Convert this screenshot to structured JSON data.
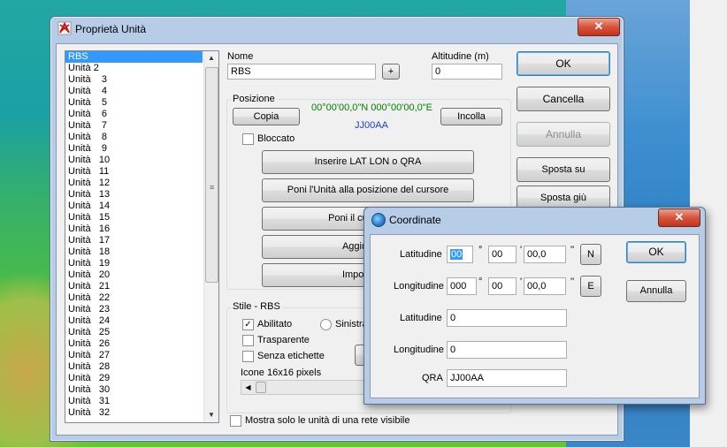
{
  "window": {
    "title": "Proprietà Unità",
    "close_label": "✕"
  },
  "unit_list": {
    "items": [
      "RBS",
      "Unità 2",
      "Unità    3",
      "Unità    4",
      "Unità    5",
      "Unità    6",
      "Unità    7",
      "Unità    8",
      "Unità    9",
      "Unità   10",
      "Unità   11",
      "Unità   12",
      "Unità   13",
      "Unità   14",
      "Unità   15",
      "Unità   16",
      "Unità   17",
      "Unità   18",
      "Unità   19",
      "Unità   20",
      "Unità   21",
      "Unità   22",
      "Unità   23",
      "Unità   24",
      "Unità   25",
      "Unità   26",
      "Unità   27",
      "Unità   28",
      "Unità   29",
      "Unità   30",
      "Unità   31",
      "Unità   32"
    ],
    "selected_index": 0
  },
  "name": {
    "label": "Nome",
    "value": "RBS",
    "plus_label": "+"
  },
  "altitude": {
    "label": "Altitudine (m)",
    "value": "0"
  },
  "position": {
    "group_label": "Posizione",
    "copy_label": "Copia",
    "paste_label": "Incolla",
    "coords": "00°00'00,0\"N 000°00'00,0\"E",
    "qra": "JJ00AA",
    "coords_color": "#008000",
    "qra_color": "#1f3fbf",
    "locked_label": "Bloccato",
    "buttons": [
      "Inserire LAT LON o QRA",
      "Poni l'Unità alla posizione del cursore",
      "Poni il cursore alla",
      "Aggiungi un",
      "Importa unit"
    ]
  },
  "right_buttons": {
    "ok": "OK",
    "cancel": "Cancella",
    "undo": "Annulla",
    "move_up": "Sposta su",
    "move_down": "Sposta giù"
  },
  "style": {
    "group_label": "Stile - RBS",
    "enabled_label": "Abilitato",
    "left_label": "Sinistra",
    "transparent_label": "Trasparente",
    "no_labels_label": "Senza etichette",
    "icons_label": "Icone 16x16 pixels"
  },
  "show_only_label": "Mostra solo le unità di una rete visibile",
  "coord_dialog": {
    "title": "Coordinate",
    "close_label": "✕",
    "lat_label": "Latitudine",
    "lat_deg": "00",
    "lat_min": "00",
    "lat_sec": "00,0",
    "lat_hemi": "N",
    "lon_label": "Longitudine",
    "lon_deg": "000",
    "lon_min": "00",
    "lon_sec": "00,0",
    "lon_hemi": "E",
    "deg_sym": "°",
    "min_sym": "'",
    "sec_sym": "''",
    "ok": "OK",
    "cancel": "Annulla",
    "lat_decimal_label": "Latitudine",
    "lat_decimal": "0",
    "lon_decimal_label": "Longitudine",
    "lon_decimal": "0",
    "qra_label": "QRA",
    "qra_value": "JJ00AA"
  }
}
